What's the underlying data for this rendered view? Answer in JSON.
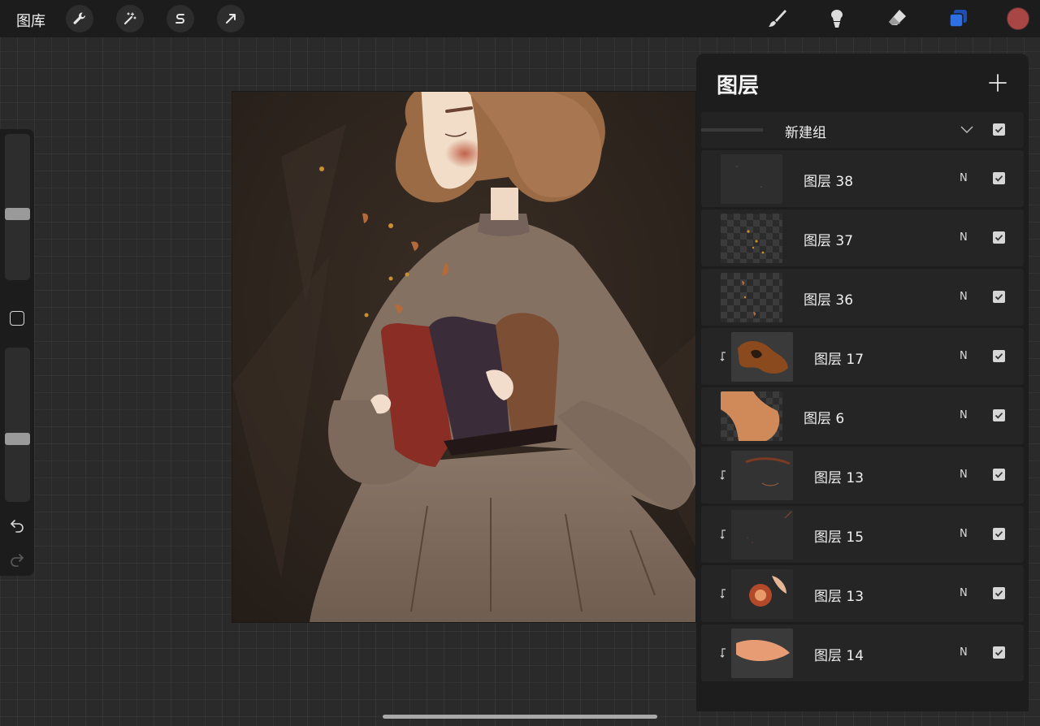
{
  "topbar": {
    "gallery_label": "图库",
    "left_tools": [
      {
        "icon": "wrench-icon"
      },
      {
        "icon": "magic-wand-icon"
      },
      {
        "icon": "selection-s-icon"
      },
      {
        "icon": "move-arrow-icon"
      }
    ],
    "right_tools": [
      {
        "icon": "brush-icon"
      },
      {
        "icon": "smudge-icon"
      },
      {
        "icon": "eraser-icon"
      },
      {
        "icon": "layers-icon",
        "active": true,
        "color": "#2f6fe4"
      }
    ],
    "current_color": "#a84646"
  },
  "sidebar": {
    "size_slider_level": 0.45,
    "opacity_slider_level": 0.4,
    "icons": [
      "modify-square",
      "undo-icon",
      "redo-icon"
    ]
  },
  "layers_panel": {
    "title": "图层",
    "add_icon": "plus-icon",
    "group": {
      "name": "新建组",
      "visible": true
    },
    "layers": [
      {
        "name": "图层 38",
        "blend": "N",
        "visible": true,
        "clipped": false,
        "thumb": "texture"
      },
      {
        "name": "图层 37",
        "blend": "N",
        "visible": true,
        "clipped": false,
        "thumb": "checker-sparkles"
      },
      {
        "name": "图层 36",
        "blend": "N",
        "visible": true,
        "clipped": false,
        "thumb": "checker-leaves"
      },
      {
        "name": "图层 17",
        "blend": "N",
        "visible": true,
        "clipped": true,
        "thumb": "hair-orange"
      },
      {
        "name": "图层 6",
        "blend": "N",
        "visible": true,
        "clipped": false,
        "thumb": "checker-skin"
      },
      {
        "name": "图层 13",
        "blend": "N",
        "visible": true,
        "clipped": true,
        "thumb": "eye-line"
      },
      {
        "name": "图层 15",
        "blend": "N",
        "visible": true,
        "clipped": true,
        "thumb": "dark-specks"
      },
      {
        "name": "图层 13",
        "blend": "N",
        "visible": true,
        "clipped": true,
        "thumb": "face-glow"
      },
      {
        "name": "图层 14",
        "blend": "N",
        "visible": true,
        "clipped": true,
        "thumb": "leaf-shape"
      }
    ]
  },
  "colors": {
    "canvas_bg": "#2a2a2b",
    "toolbar_bg": "#1c1c1d",
    "panel_bg": "#1d1d1e",
    "row_bg": "#252526",
    "accent_blue": "#2f6fe4"
  }
}
